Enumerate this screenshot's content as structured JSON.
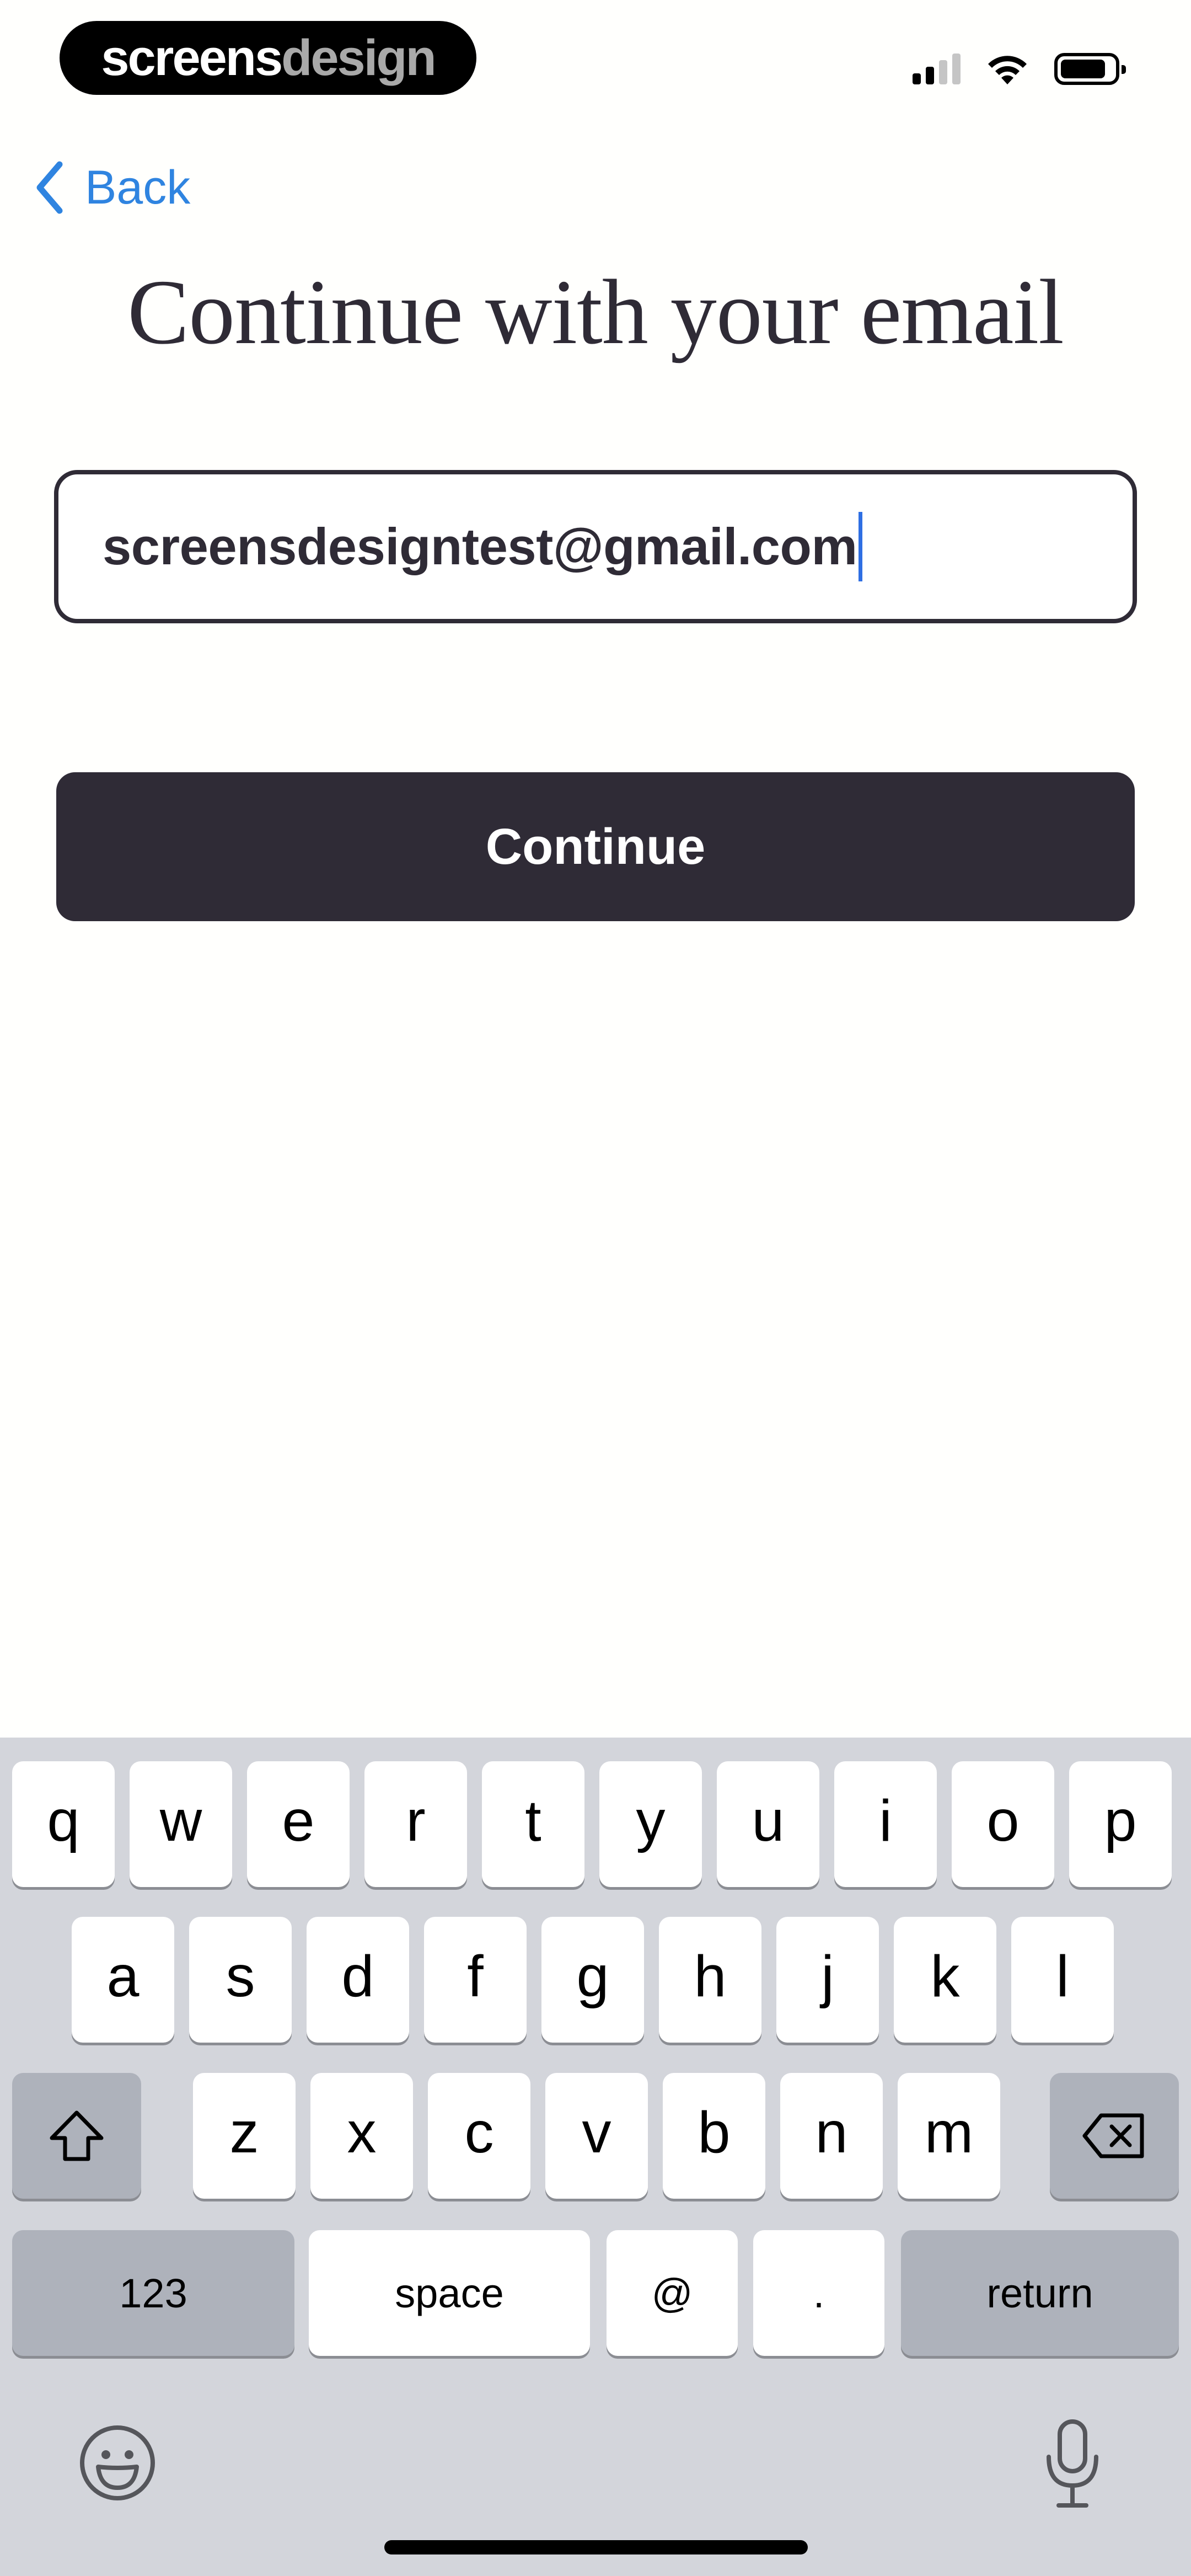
{
  "status_bar": {
    "brand_part1": "screens",
    "brand_part2": "design",
    "battery_level": 0.85,
    "signal_bars_active": 2,
    "signal_bars_total": 4
  },
  "nav": {
    "back_label": "Back"
  },
  "page": {
    "title": "Continue with your email"
  },
  "email_input": {
    "value": "screensdesigntest@gmail.com"
  },
  "continue_button": {
    "label": "Continue"
  },
  "keyboard": {
    "row1": [
      "q",
      "w",
      "e",
      "r",
      "t",
      "y",
      "u",
      "i",
      "o",
      "p"
    ],
    "row2": [
      "a",
      "s",
      "d",
      "f",
      "g",
      "h",
      "j",
      "k",
      "l"
    ],
    "row3": [
      "z",
      "x",
      "c",
      "v",
      "b",
      "n",
      "m"
    ],
    "numbers_label": "123",
    "space_label": "space",
    "at_label": "@",
    "dot_label": ".",
    "return_label": "return",
    "icons": {
      "shift": "shift-icon",
      "delete": "delete-icon",
      "emoji": "emoji-icon",
      "dictation": "microphone-icon"
    }
  },
  "colors": {
    "text_dark": "#2f2b36",
    "link_blue": "#2f84e0",
    "button_bg": "#2f2b36",
    "caret": "#2f6fe3",
    "keyboard_bg": "#d3d5db",
    "key_dark": "#aeb2bb"
  }
}
